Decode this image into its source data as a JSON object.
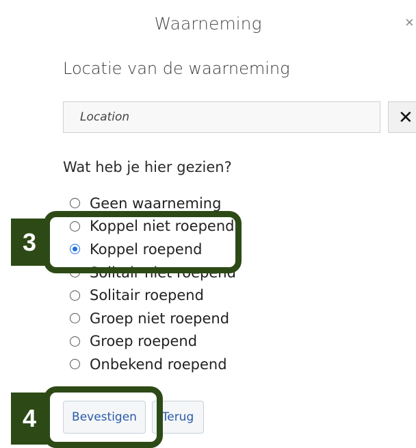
{
  "dialog": {
    "title": "Waarneming",
    "close_label": "×"
  },
  "location": {
    "heading": "Locatie van de waarneming",
    "input_placeholder": "Location",
    "input_value": "",
    "clear_label": "✕"
  },
  "observation": {
    "question": "Wat heb je hier gezien?",
    "options": [
      {
        "label": "Geen waarneming",
        "checked": false
      },
      {
        "label": "Koppel niet roepend",
        "checked": false
      },
      {
        "label": "Koppel roepend",
        "checked": true
      },
      {
        "label": "Solitair niet roepend",
        "checked": false
      },
      {
        "label": "Solitair roepend",
        "checked": false
      },
      {
        "label": "Groep niet roepend",
        "checked": false
      },
      {
        "label": "Groep roepend",
        "checked": false
      },
      {
        "label": "Onbekend roepend",
        "checked": false
      }
    ]
  },
  "buttons": {
    "confirm_label": "Bevestigen",
    "back_label": "Terug"
  },
  "annotations": {
    "step_3": "3",
    "step_4": "4",
    "color": "#2d4a16"
  },
  "colors": {
    "radio_checked": "#1f6fe5",
    "button_text": "#2a5aa8"
  }
}
